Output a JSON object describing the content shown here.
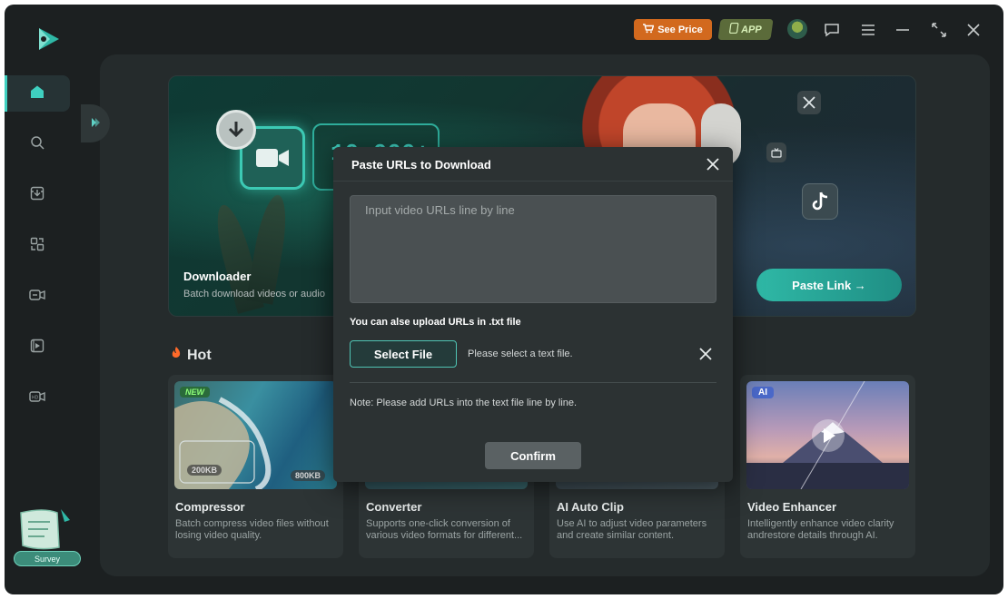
{
  "titlebar": {
    "see_price": "See Price",
    "app": "APP"
  },
  "sidebar": {
    "items": [
      {
        "icon": "home-icon"
      },
      {
        "icon": "search-icon"
      },
      {
        "icon": "download-box-icon"
      },
      {
        "icon": "convert-icon"
      },
      {
        "icon": "video-convert-icon"
      },
      {
        "icon": "video-clip-icon"
      },
      {
        "icon": "hd-video-icon"
      }
    ],
    "survey": "Survey"
  },
  "banner": {
    "title": "Downloader",
    "subtitle": "Batch download videos or audio",
    "counter": "10,000+",
    "paste_link": "Paste Link →"
  },
  "hot": {
    "label": "Hot",
    "cards": [
      {
        "title": "Compressor",
        "desc": "Batch compress video files without losing video quality.",
        "badge": "NEW",
        "size_before": "200KB",
        "size_after": "800KB"
      },
      {
        "title": "Converter",
        "desc": "Supports one-click conversion of various video formats for different..."
      },
      {
        "title": "AI Auto Clip",
        "desc": "Use AI to adjust video parameters and create similar content."
      },
      {
        "title": "Video Enhancer",
        "desc": "Intelligently enhance video clarity andrestore details through AI.",
        "badge": "AI"
      }
    ]
  },
  "dialog": {
    "title": "Paste URLs to Download",
    "placeholder": "Input video URLs line by line",
    "upload_hint": "You can alse upload URLs in .txt file",
    "select_file": "Select File",
    "file_status": "Please select a text file.",
    "note": "Note: Please add URLs into the text file line by line.",
    "confirm": "Confirm"
  },
  "colors": {
    "accent": "#3fd0c0",
    "price": "#d2691e",
    "background": "#1c2021"
  }
}
